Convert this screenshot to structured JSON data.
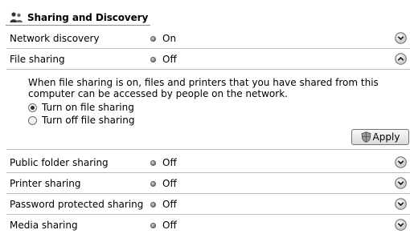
{
  "header": {
    "title": "Sharing and Discovery",
    "icon": "people-icon"
  },
  "rows": [
    {
      "label": "Network discovery",
      "value": "On",
      "chevron": "down"
    },
    {
      "label": "File sharing",
      "value": "Off",
      "chevron": "up"
    },
    {
      "label": "Public folder sharing",
      "value": "Off",
      "chevron": "down"
    },
    {
      "label": "Printer sharing",
      "value": "Off",
      "chevron": "down"
    },
    {
      "label": "Password protected sharing",
      "value": "Off",
      "chevron": "down"
    },
    {
      "label": "Media sharing",
      "value": "Off",
      "chevron": "down"
    }
  ],
  "file_sharing_details": {
    "description": "When file sharing is on, files and printers that you have shared from this computer can be accessed by people on the network.",
    "options": [
      {
        "label": "Turn on file sharing",
        "selected": true
      },
      {
        "label": "Turn off file sharing",
        "selected": false
      }
    ],
    "apply_label": "Apply"
  }
}
